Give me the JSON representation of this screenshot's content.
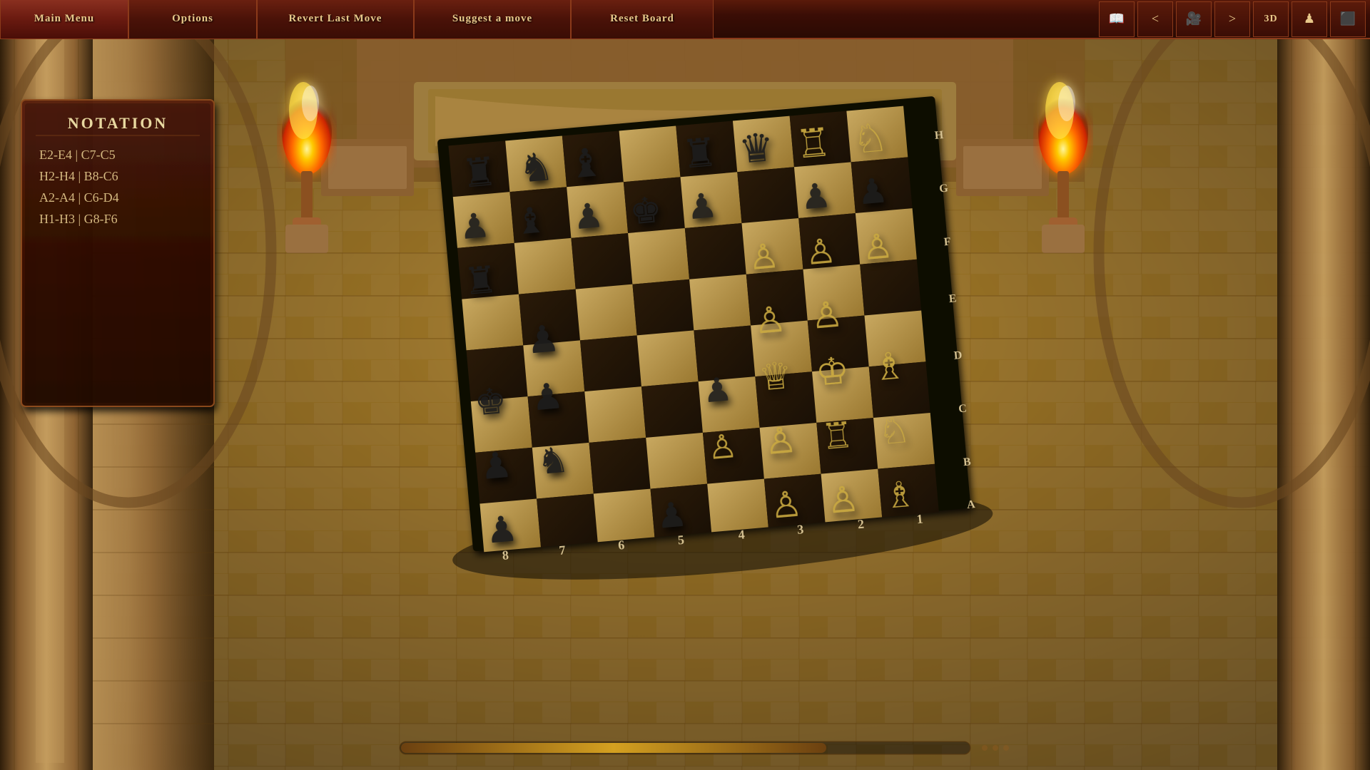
{
  "menubar": {
    "main_menu_label": "Main Menu",
    "options_label": "Options",
    "revert_last_move_label": "Revert Last Move",
    "suggest_move_label": "Suggest a move",
    "reset_board_label": "Reset Board",
    "btn_3d_label": "3D",
    "btn_prev_label": "<",
    "btn_next_label": ">",
    "book_icon": "📖",
    "camera_icon": "🎥",
    "person_icon": "♟",
    "checkerboard_icon": "⬛"
  },
  "notation": {
    "title": "Notation",
    "moves": [
      "E2-E4 | C7-C5",
      "H2-H4 | B8-C6",
      "A2-A4 | C6-D4",
      "H1-H3 | G8-F6"
    ]
  },
  "board": {
    "row_labels": [
      "8",
      "7",
      "6",
      "5",
      "4",
      "3",
      "2",
      "1"
    ],
    "col_labels": [
      "A",
      "B",
      "C",
      "D",
      "E",
      "F",
      "G",
      "H"
    ]
  },
  "progress": {
    "fill_width": "75%"
  }
}
